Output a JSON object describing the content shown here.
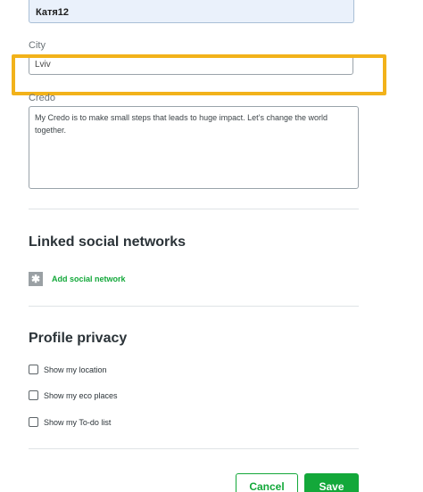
{
  "form": {
    "name_value": "Катя12",
    "city_label": "City",
    "city_value": "Lviv",
    "credo_label": "Credo",
    "credo_value": "My Credo is to make small steps that leads to huge impact. Let’s change the world together."
  },
  "social": {
    "title": "Linked social networks",
    "add_label": "Add social network"
  },
  "privacy": {
    "title": "Profile privacy",
    "options": [
      {
        "label": "Show my location",
        "checked": false
      },
      {
        "label": "Show my eco places",
        "checked": false
      },
      {
        "label": "Show my To-do list",
        "checked": false
      }
    ]
  },
  "actions": {
    "cancel_label": "Cancel",
    "save_label": "Save"
  },
  "colors": {
    "accent_green": "#13a83a",
    "highlight_yellow": "#f2b21a"
  }
}
